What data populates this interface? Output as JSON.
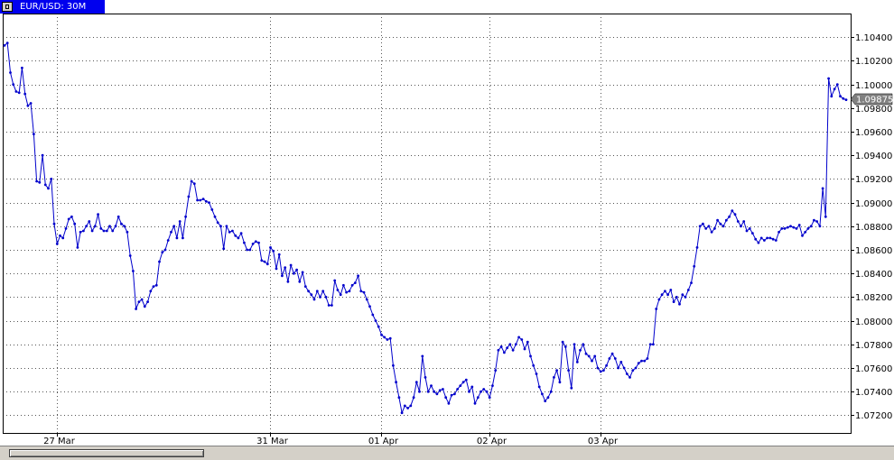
{
  "window": {
    "title": "EUR/USD: 30M"
  },
  "colors": {
    "line": "#0000cc",
    "grid": "#555555",
    "tab": "#0000ee",
    "price_label": "#808080"
  },
  "chart_data": {
    "type": "line",
    "title": "EUR/USD: 30M",
    "symbol": "EUR/USD",
    "timeframe": "30M",
    "y_axis_position": "right",
    "ylim": [
      1.0705,
      1.106
    ],
    "y_ticks": [
      "1.10400",
      "1.10200",
      "1.10000",
      "1.09800",
      "1.09600",
      "1.09400",
      "1.09200",
      "1.09000",
      "1.08800",
      "1.08600",
      "1.08400",
      "1.08200",
      "1.08000",
      "1.07800",
      "1.07600",
      "1.07400",
      "1.07200"
    ],
    "x_ticks": [
      {
        "label": "27 Mar",
        "index": 18
      },
      {
        "label": "31 Mar",
        "index": 91
      },
      {
        "label": "01 Apr",
        "index": 129
      },
      {
        "label": "02 Apr",
        "index": 166
      },
      {
        "label": "03 Apr",
        "index": 204
      }
    ],
    "current_price": "1.09875",
    "grid": true,
    "series": [
      {
        "values": [
          1.1033,
          1.1035,
          1.101,
          1.1,
          1.0994,
          1.0993,
          1.1014,
          1.0992,
          1.0982,
          1.0984,
          1.0958,
          1.0918,
          1.0917,
          1.094,
          1.0915,
          1.0912,
          1.092,
          1.0882,
          1.0865,
          1.0872,
          1.087,
          1.0878,
          1.0886,
          1.0888,
          1.0882,
          1.0862,
          1.0875,
          1.0876,
          1.088,
          1.0884,
          1.0876,
          1.088,
          1.089,
          1.0878,
          1.0876,
          1.0876,
          1.088,
          1.0876,
          1.088,
          1.0888,
          1.0882,
          1.088,
          1.0875,
          1.0855,
          1.0842,
          1.081,
          1.0816,
          1.0818,
          1.0812,
          1.0816,
          1.0825,
          1.0829,
          1.083,
          1.085,
          1.0858,
          1.086,
          1.0868,
          1.0875,
          1.088,
          1.087,
          1.0884,
          1.087,
          1.0888,
          1.0905,
          1.0918,
          1.0916,
          1.0902,
          1.0902,
          1.0903,
          1.0901,
          1.09,
          1.0894,
          1.0888,
          1.0883,
          1.088,
          1.0861,
          1.088,
          1.0875,
          1.0876,
          1.0872,
          1.087,
          1.0874,
          1.0866,
          1.086,
          1.086,
          1.0865,
          1.0867,
          1.0866,
          1.0851,
          1.085,
          1.0848,
          1.0862,
          1.0859,
          1.0844,
          1.0856,
          1.0838,
          1.0845,
          1.0833,
          1.0847,
          1.084,
          1.0843,
          1.0833,
          1.0841,
          1.0829,
          1.0825,
          1.0822,
          1.0818,
          1.0825,
          1.082,
          1.0825,
          1.082,
          1.0813,
          1.0813,
          1.0834,
          1.0826,
          1.0822,
          1.083,
          1.0824,
          1.0825,
          1.083,
          1.0832,
          1.0838,
          1.0825,
          1.0824,
          1.0818,
          1.0812,
          1.0805,
          1.08,
          1.0795,
          1.0788,
          1.0786,
          1.0784,
          1.0785,
          1.0762,
          1.0748,
          1.0735,
          1.0722,
          1.0728,
          1.0726,
          1.0728,
          1.0735,
          1.0748,
          1.074,
          1.077,
          1.0752,
          1.074,
          1.0745,
          1.074,
          1.0738,
          1.0741,
          1.0742,
          1.0735,
          1.073,
          1.0737,
          1.0738,
          1.0742,
          1.0745,
          1.0748,
          1.075,
          1.074,
          1.0744,
          1.073,
          1.0735,
          1.074,
          1.0742,
          1.074,
          1.0735,
          1.0745,
          1.0758,
          1.0775,
          1.0778,
          1.0773,
          1.0777,
          1.078,
          1.0775,
          1.078,
          1.0786,
          1.0784,
          1.0776,
          1.0782,
          1.077,
          1.0762,
          1.0755,
          1.0744,
          1.0738,
          1.0732,
          1.0735,
          1.074,
          1.0752,
          1.0758,
          1.0748,
          1.0782,
          1.0778,
          1.0758,
          1.0743,
          1.078,
          1.0765,
          1.0775,
          1.078,
          1.0772,
          1.077,
          1.0766,
          1.077,
          1.076,
          1.0757,
          1.0758,
          1.0762,
          1.0768,
          1.0772,
          1.0768,
          1.076,
          1.0765,
          1.076,
          1.0755,
          1.0752,
          1.0758,
          1.076,
          1.0764,
          1.0766,
          1.0766,
          1.0768,
          1.078,
          1.078,
          1.081,
          1.0818,
          1.0822,
          1.0825,
          1.0822,
          1.0826,
          1.0816,
          1.082,
          1.0814,
          1.0822,
          1.082,
          1.0826,
          1.0832,
          1.0846,
          1.0862,
          1.088,
          1.0882,
          1.0878,
          1.088,
          1.0875,
          1.0878,
          1.0885,
          1.0882,
          1.088,
          1.0885,
          1.0888,
          1.0893,
          1.089,
          1.0884,
          1.088,
          1.0884,
          1.0876,
          1.0878,
          1.0874,
          1.0869,
          1.0866,
          1.087,
          1.0868,
          1.087,
          1.087,
          1.0869,
          1.0868,
          1.0875,
          1.0878,
          1.0878,
          1.0879,
          1.088,
          1.0879,
          1.0878,
          1.0881,
          1.0872,
          1.0875,
          1.0878,
          1.088,
          1.0885,
          1.0884,
          1.088,
          1.0912,
          1.0888,
          1.1005,
          1.099,
          1.0996,
          1.1,
          1.099,
          1.0988,
          1.0987
        ]
      }
    ]
  }
}
